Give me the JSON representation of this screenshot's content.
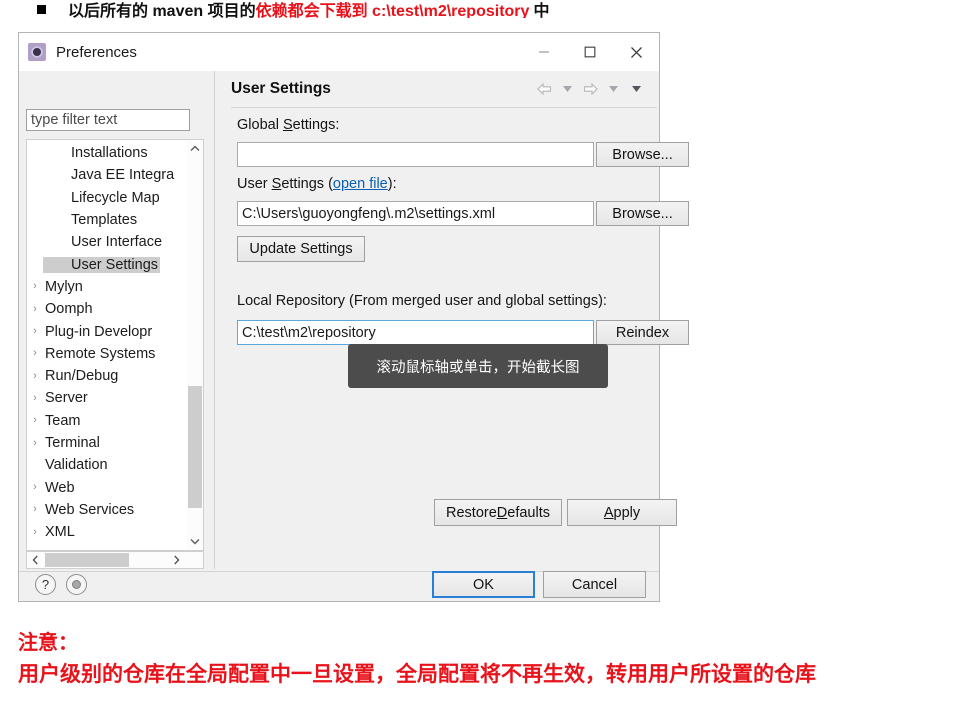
{
  "top_note": {
    "bullet": "■",
    "text_plain_1": "以后所有的 maven 项目的",
    "text_red": "依赖都会下载到 c:\\test\\m2\\repository",
    "text_plain_2": "中"
  },
  "dialog": {
    "title": "Preferences",
    "window_buttons": {
      "minimize": "minimize-icon",
      "maximize": "maximize-icon",
      "close": "close-icon"
    },
    "filter": {
      "placeholder": "type filter text",
      "value": ""
    },
    "tree": {
      "items": [
        {
          "label": "Installations",
          "level": "child",
          "expandable": false,
          "selected": false
        },
        {
          "label": "Java EE Integra",
          "level": "child",
          "expandable": false,
          "selected": false
        },
        {
          "label": "Lifecycle Map",
          "level": "child",
          "expandable": false,
          "selected": false
        },
        {
          "label": "Templates",
          "level": "child",
          "expandable": false,
          "selected": false
        },
        {
          "label": "User Interface",
          "level": "child",
          "expandable": false,
          "selected": false
        },
        {
          "label": "User Settings",
          "level": "child",
          "expandable": false,
          "selected": true
        },
        {
          "label": "Mylyn",
          "level": "parent",
          "expandable": true,
          "selected": false
        },
        {
          "label": "Oomph",
          "level": "parent",
          "expandable": true,
          "selected": false
        },
        {
          "label": "Plug-in Developr",
          "level": "parent",
          "expandable": true,
          "selected": false
        },
        {
          "label": "Remote Systems",
          "level": "parent",
          "expandable": true,
          "selected": false
        },
        {
          "label": "Run/Debug",
          "level": "parent",
          "expandable": true,
          "selected": false
        },
        {
          "label": "Server",
          "level": "parent",
          "expandable": true,
          "selected": false
        },
        {
          "label": "Team",
          "level": "parent",
          "expandable": true,
          "selected": false
        },
        {
          "label": "Terminal",
          "level": "parent",
          "expandable": true,
          "selected": false
        },
        {
          "label": "Validation",
          "level": "parent",
          "expandable": false,
          "selected": false
        },
        {
          "label": "Web",
          "level": "parent",
          "expandable": true,
          "selected": false
        },
        {
          "label": "Web Services",
          "level": "parent",
          "expandable": true,
          "selected": false
        },
        {
          "label": "XML",
          "level": "parent",
          "expandable": true,
          "selected": false
        }
      ],
      "expand_arrow": "›",
      "scroll_up": "chevron-up-icon",
      "scroll_down": "chevron-down-icon",
      "scroll_left": "chevron-left-icon",
      "scroll_right": "chevron-right-icon"
    },
    "panel": {
      "title": "User Settings",
      "toolbar": [
        "back-arrow-icon",
        "back-dropdown-icon",
        "forward-arrow-icon",
        "forward-dropdown-icon",
        "view-menu-icon"
      ],
      "global_settings": {
        "label_pre": "Global ",
        "label_mnemonic": "S",
        "label_post": "ettings:",
        "value": "",
        "browse_label": "Browse..."
      },
      "user_settings": {
        "label_pre": "User ",
        "label_mnemonic": "S",
        "label_mid": "ettings (",
        "link": "open file",
        "label_post": "):",
        "value": "C:\\Users\\guoyongfeng\\.m2\\settings.xml",
        "browse_label": "Browse..."
      },
      "update_settings_label": "Update Settings",
      "local_repository": {
        "label": "Local Repository (From merged user and global settings):",
        "value": "C:\\test\\m2\\repository",
        "reindex_label": "Reindex"
      },
      "restore_defaults": {
        "pre": "Restore ",
        "mnemonic": "D",
        "post": "efaults"
      },
      "apply": {
        "pre": "",
        "mnemonic": "A",
        "post": "pply"
      }
    },
    "footer": {
      "help_icon": "?",
      "record_icon": "record-dot-icon",
      "ok_label": "OK",
      "cancel_label": "Cancel"
    }
  },
  "tooltip": {
    "text": "滚动鼠标轴或单击，开始截长图"
  },
  "bottom_notes": {
    "heading": "注意：",
    "body": "用户级别的仓库在全局配置中一旦设置，全局配置将不再生效，转用用户所设置的仓库"
  },
  "colors": {
    "red": "#e8121b",
    "link": "#0a5fb4",
    "focus_blue": "#2a7fd4",
    "selection_gray": "#cdcdcd",
    "tooltip_bg": "#4c4c4c"
  }
}
